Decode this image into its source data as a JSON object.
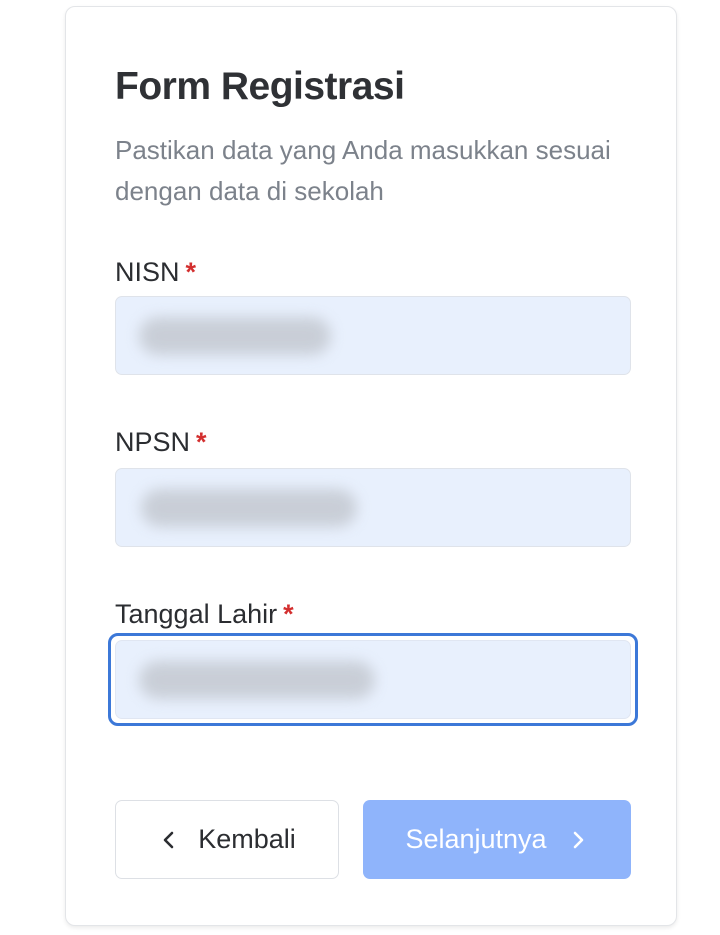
{
  "form": {
    "title": "Form Registrasi",
    "subtitle": "Pastikan data yang Anda masukkan sesuai dengan data di sekolah",
    "required_marker": "*",
    "fields": [
      {
        "label": "NISN",
        "value": ""
      },
      {
        "label": "NPSN",
        "value": ""
      },
      {
        "label": "Tanggal Lahir",
        "value": ""
      }
    ]
  },
  "actions": {
    "back_label": "Kembali",
    "next_label": "Selanjutnya"
  },
  "colors": {
    "required": "#d32f2f",
    "input_bg": "#e8f0fd",
    "focus": "#3c78d8",
    "next_button": "#8fb4fb"
  },
  "icons": {
    "back": "chevron-left-icon",
    "next": "chevron-right-icon"
  }
}
